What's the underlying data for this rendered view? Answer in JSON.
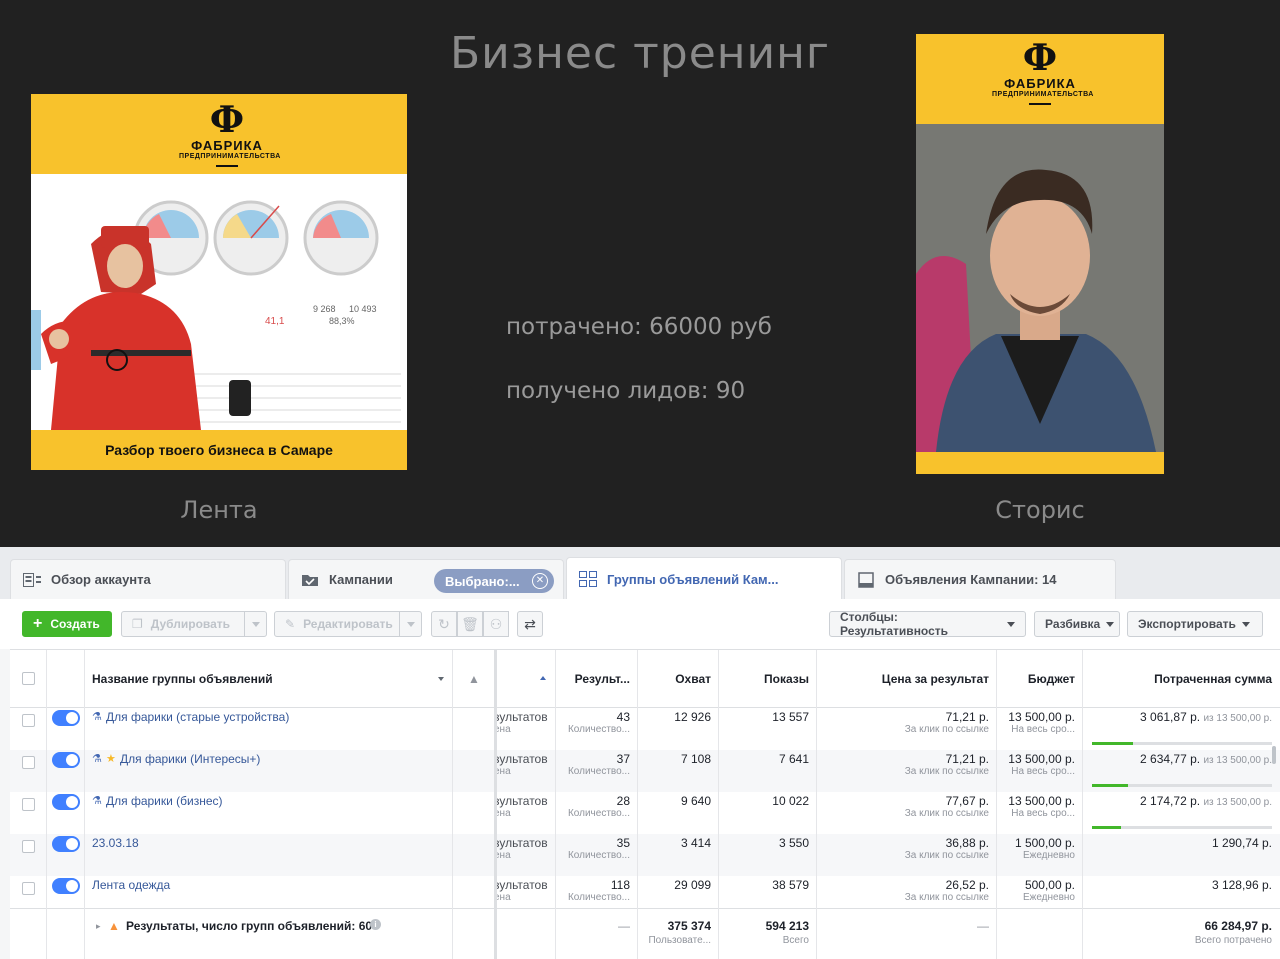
{
  "slide": {
    "title": "Бизнес тренинг",
    "spent": "потрачено: 66000 руб",
    "leads": "получено лидов: 90",
    "feed_caption": "Лента",
    "stories_caption": "Сторис",
    "brand": {
      "mark": "Ф",
      "name": "ФАБРИКА",
      "sub": "ПРЕДПРИНИМАТЕЛЬСТВА"
    },
    "feed_banner": "Разбор твоего бизнеса в Самаре",
    "feed_readouts": [
      "41,1",
      "9 268",
      "10 493",
      "88,3%"
    ],
    "colors": {
      "yellow": "#f8c22c",
      "background": "#212121"
    }
  },
  "ads": {
    "tabs": [
      {
        "label": "Обзор аккаунта",
        "icon": "account-overview-icon"
      },
      {
        "label": "Кампании",
        "icon": "campaigns-folder-icon"
      },
      {
        "label": "Группы объявлений Кам...",
        "icon": "ad-sets-grid-icon",
        "active": true
      },
      {
        "label": "Объявления Кампании: 14",
        "icon": "ads-icon"
      }
    ],
    "selected_chip": "Выбрано:...",
    "toolbar": {
      "create": "Создать",
      "duplicate": "Дублировать",
      "edit": "Редактировать",
      "columns": "Столбцы: Результативность",
      "breakdown": "Разбивка",
      "export": "Экспортировать"
    },
    "columns": {
      "name": "Название группы объявлений",
      "results": "Результ...",
      "reach": "Охват",
      "impressions": "Показы",
      "cpr": "Цена за результат",
      "budget": "Бюджет",
      "spent": "Потраченная сумма"
    },
    "rows": [
      {
        "name": "Для фарики (старые устройства)",
        "icons": [
          "flask-icon"
        ],
        "type": "зультатов",
        "type_sub": "ена",
        "results": "43",
        "results_sub": "Количество...",
        "reach": "12 926",
        "impressions": "13 557",
        "cpr": "71,21 р.",
        "cpr_sub": "За клик по ссылке",
        "budget": "13 500,00 р.",
        "budget_sub": "На весь сро...",
        "spent": "3 061,87 р.",
        "spent_of": "из 13 500,00 р.",
        "progress": 0.23
      },
      {
        "name": "Для фарики (Интересы+)",
        "icons": [
          "flask-icon",
          "star-icon"
        ],
        "type": "зультатов",
        "type_sub": "ена",
        "results": "37",
        "results_sub": "Количество...",
        "reach": "7 108",
        "impressions": "7 641",
        "cpr": "71,21 р.",
        "cpr_sub": "За клик по ссылке",
        "budget": "13 500,00 р.",
        "budget_sub": "На весь сро...",
        "spent": "2 634,77 р.",
        "spent_of": "из 13 500,00 р.",
        "progress": 0.2
      },
      {
        "name": "Для фарики (бизнес)",
        "icons": [
          "flask-icon"
        ],
        "type": "зультатов",
        "type_sub": "ена",
        "results": "28",
        "results_sub": "Количество...",
        "reach": "9 640",
        "impressions": "10 022",
        "cpr": "77,67 р.",
        "cpr_sub": "За клик по ссылке",
        "budget": "13 500,00 р.",
        "budget_sub": "На весь сро...",
        "spent": "2 174,72 р.",
        "spent_of": "из 13 500,00 р.",
        "progress": 0.16
      },
      {
        "name": "23.03.18",
        "icons": [],
        "type": "зультатов",
        "type_sub": "ена",
        "results": "35",
        "results_sub": "Количество...",
        "reach": "3 414",
        "impressions": "3 550",
        "cpr": "36,88 р.",
        "cpr_sub": "За клик по ссылке",
        "budget": "1 500,00 р.",
        "budget_sub": "Ежедневно",
        "spent": "1 290,74 р.",
        "spent_of": "",
        "progress": null
      },
      {
        "name": "Лента одежда",
        "icons": [],
        "type": "зультатов",
        "type_sub": "ена",
        "results": "118",
        "results_sub": "Количество...",
        "reach": "29 099",
        "impressions": "38 579",
        "cpr": "26,52 р.",
        "cpr_sub": "За клик по ссылке",
        "budget": "500,00 р.",
        "budget_sub": "Ежедневно",
        "spent": "3 128,96 р.",
        "spent_of": "",
        "progress": null
      }
    ],
    "footer": {
      "label": "Результаты, число групп объявлений: 60",
      "results": "—",
      "reach": "375 374",
      "reach_sub": "Пользовате...",
      "impressions": "594 213",
      "impressions_sub": "Всего",
      "cpr": "—",
      "spent": "66 284,97 р.",
      "spent_sub": "Всего потрачено"
    },
    "colors": {
      "accent": "#4267b2",
      "green": "#42b72a",
      "toggle": "#4080ff"
    }
  }
}
